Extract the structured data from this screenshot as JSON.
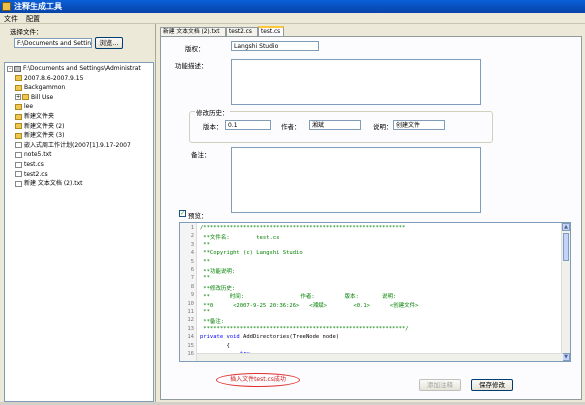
{
  "window": {
    "title": "注释生成工具"
  },
  "menu": {
    "file": "文件",
    "config": "配置"
  },
  "left": {
    "select_file_label": "选择文件：",
    "path_value": "F:\\Documents and Settings",
    "browse_label": "浏览...",
    "tree": [
      {
        "label": "F:\\Documents and Settings\\Administrat",
        "type": "drive",
        "level": 0,
        "expander": "-"
      },
      {
        "label": "2007.8.6-2007.9.15",
        "type": "folder",
        "level": 1,
        "expander": ""
      },
      {
        "label": "Backgammon",
        "type": "folder",
        "level": 1,
        "expander": ""
      },
      {
        "label": "Bill Use",
        "type": "folder",
        "level": 1,
        "expander": "+"
      },
      {
        "label": "lee",
        "type": "folder",
        "level": 1,
        "expander": ""
      },
      {
        "label": "新建文件夹",
        "type": "folder",
        "level": 1,
        "expander": ""
      },
      {
        "label": "新建文件夹 (2)",
        "type": "folder",
        "level": 1,
        "expander": ""
      },
      {
        "label": "新建文件夹 (3)",
        "type": "folder",
        "level": 1,
        "expander": ""
      },
      {
        "label": "嵌入式周工作计划(2007[1].9.17-2007",
        "type": "file",
        "level": 1,
        "expander": ""
      },
      {
        "label": "note5.txt",
        "type": "file",
        "level": 1,
        "expander": ""
      },
      {
        "label": "test.cs",
        "type": "file",
        "level": 1,
        "expander": ""
      },
      {
        "label": "test2.cs",
        "type": "file",
        "level": 1,
        "expander": ""
      },
      {
        "label": "新建 文本文档 (2).txt",
        "type": "file",
        "level": 1,
        "expander": ""
      }
    ]
  },
  "tabs": [
    {
      "label": "新建 文本文档 (2).txt"
    },
    {
      "label": "test2.cs"
    },
    {
      "label": "test.cs"
    }
  ],
  "form": {
    "copyright_label": "版权：",
    "copyright_value": "Langshi Studio",
    "description_label": "功能描述：",
    "history_group_label": "修改历史：",
    "version_label": "版本：",
    "version_value": "0.1",
    "author_label": "作者：",
    "author_value": "湘斌",
    "note_label": "说明：",
    "note_value": "创建文件",
    "remark_label": "备注：",
    "preview_label": "预览：",
    "preview_checked": "✓"
  },
  "code": {
    "lines": [
      {
        "n": "1",
        "t": "/*************************************************************"
      },
      {
        "n": "2",
        "t": " **文件名:        test.cs"
      },
      {
        "n": "3",
        "t": " **"
      },
      {
        "n": "4",
        "t": " **Copyright (c) Langshi Studio"
      },
      {
        "n": "5",
        "t": " **"
      },
      {
        "n": "6",
        "t": " **功能说明:"
      },
      {
        "n": "7",
        "t": " **"
      },
      {
        "n": "8",
        "t": " **修改历史:"
      },
      {
        "n": "9",
        "t": " **      时间:                 作者:         版本:       说明:"
      },
      {
        "n": "10",
        "t": " **0      <2007-9-25 20:36:26>   <湘斌>        <0.1>      <创建文件>"
      },
      {
        "n": "11",
        "t": " **"
      },
      {
        "n": "12",
        "t": " **备注:"
      },
      {
        "n": "13",
        "t": " *************************************************************/"
      },
      {
        "n": "14",
        "t": ""
      },
      {
        "n": "15",
        "t": ""
      },
      {
        "n": "16",
        "t": ""
      }
    ],
    "line14_kw1": "private",
    "line14_kw2": "void",
    "line14_rest": " AddDirectories(TreeNode node)",
    "line15_text": "        {",
    "line16_kw": "try"
  },
  "status": {
    "message": "插入文件test.cs成功"
  },
  "buttons": {
    "add_comment": "添加注释",
    "save_changes": "保存修改"
  }
}
